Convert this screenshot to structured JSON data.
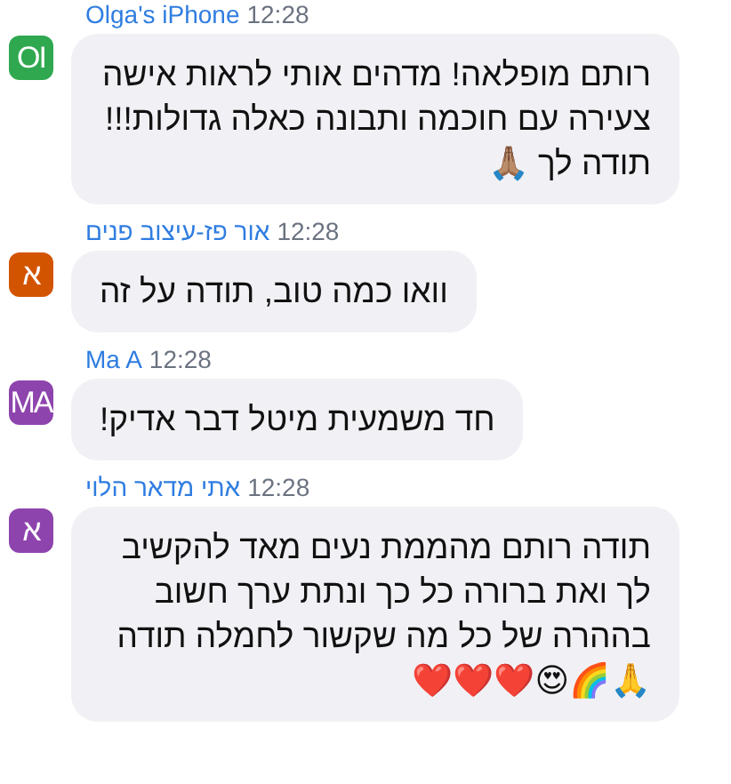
{
  "messages": [
    {
      "sender": "Olga's iPhone",
      "time": "12:28",
      "avatar": "OI",
      "color": "#2fa84f",
      "text": "רותם מופלאה! מדהים אותי לראות אישה צעירה עם חוכמה ותבונה כאלה גדולות!!! תודה לך 🙏🏽"
    },
    {
      "sender": "אור פז-עיצוב פנים",
      "time": "12:28",
      "avatar": "א",
      "color": "#d35400",
      "text": "וואו כמה טוב, תודה על זה"
    },
    {
      "sender": "Ma A",
      "time": "12:28",
      "avatar": "MA",
      "color": "#8e44ad",
      "text": "חד משמעית מיטל דבר אדיק!"
    },
    {
      "sender": "אתי מדאר הלוי",
      "time": "12:28",
      "avatar": "א",
      "color": "#8e44ad",
      "text": "תודה רותם מהממת נעים מאד להקשיב לך ואת ברורה כל כך ונתת ערך חשוב בההרה של כל מה שקשור לחמלה תודה🙏🌈😍❤️❤️❤️"
    }
  ]
}
